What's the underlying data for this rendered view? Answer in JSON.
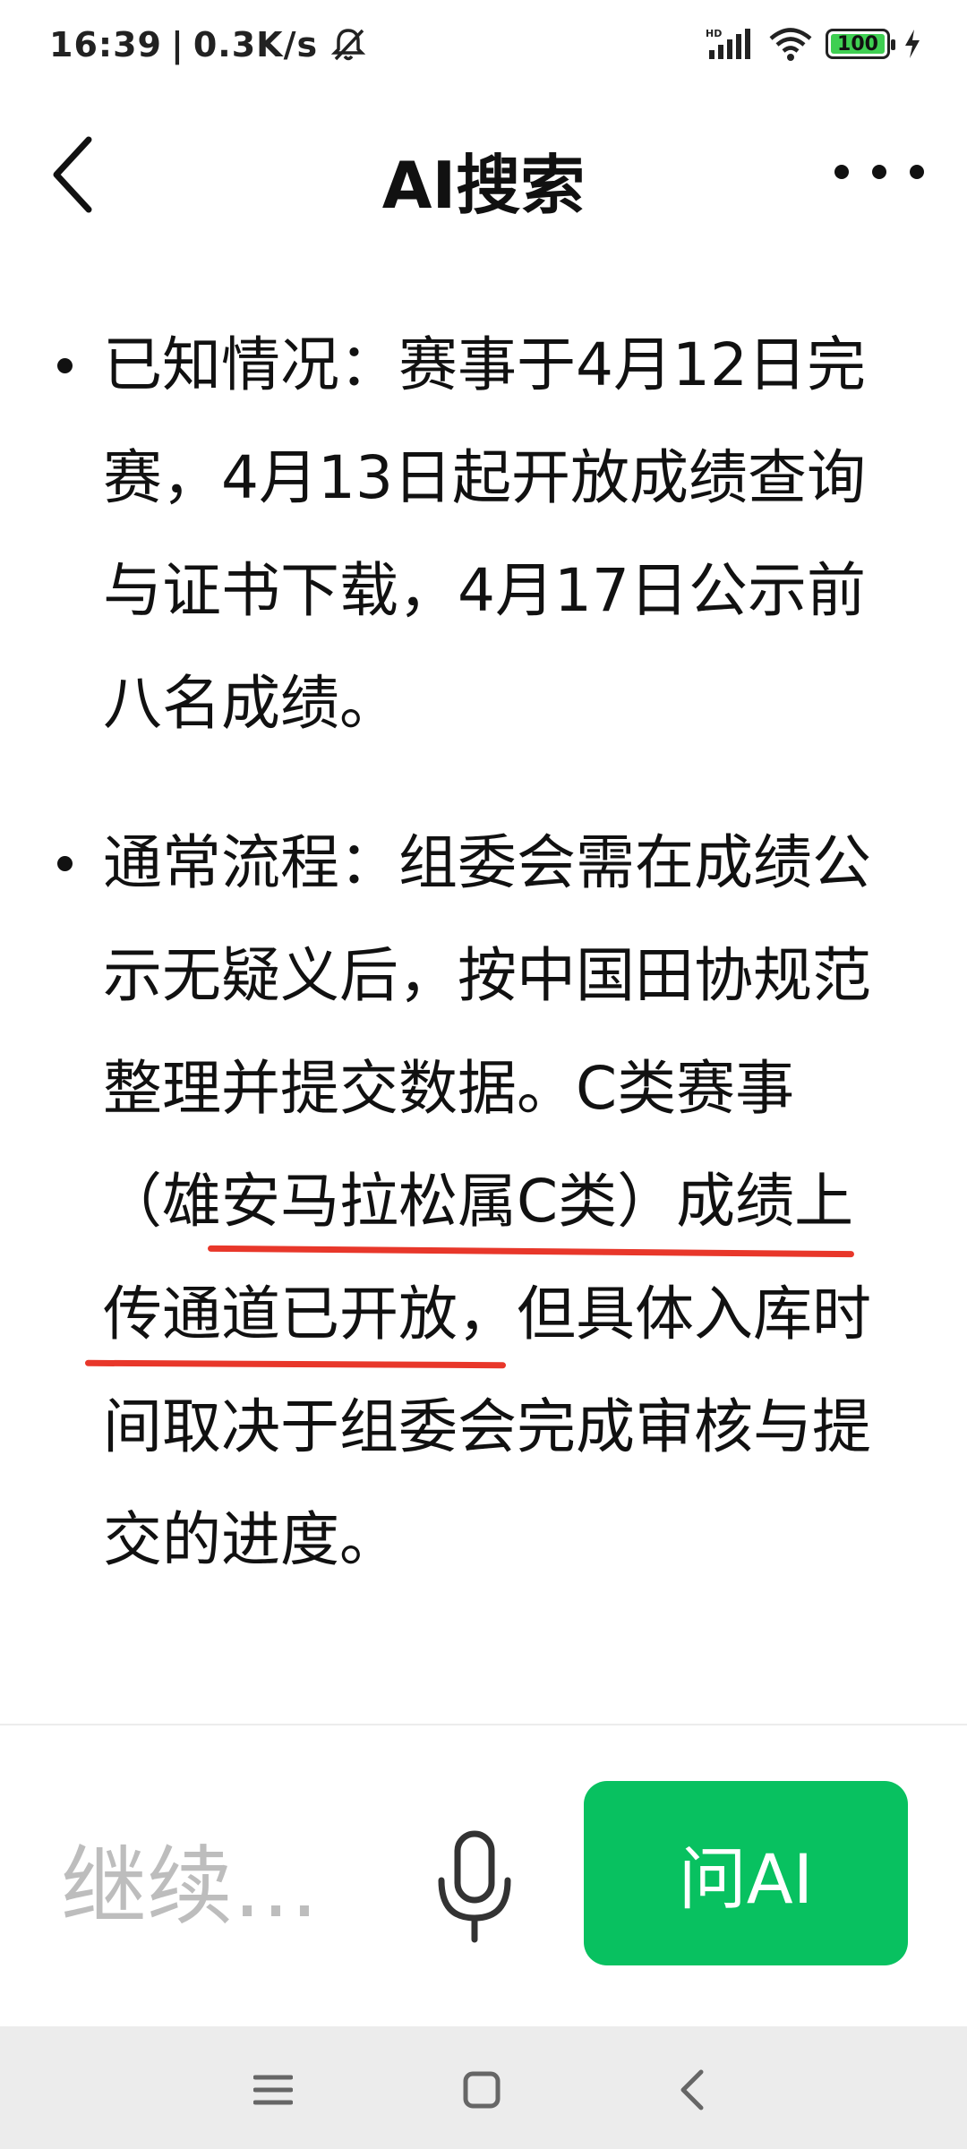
{
  "status_bar": {
    "time": "16:39",
    "separator": "|",
    "net_speed": "0.3K/s",
    "battery_level": "100",
    "icons": [
      "mute-icon",
      "hd-signal-icon",
      "wifi-icon",
      "battery-icon",
      "charging-icon"
    ]
  },
  "header": {
    "title": "AI搜索",
    "back_icon": "back-chevron-icon",
    "more_icon": "more-dots-icon"
  },
  "content": {
    "items": [
      {
        "text": "已知情况：赛事于4月12日完赛，4月13日起开放成绩查询与证书下载，4月17日公示前八名成绩。"
      },
      {
        "text": "通常流程：组委会需在成绩公示无疑义后，按中国田协规范整理并提交数据。C类赛事（雄安马拉松属C类）成绩上传通道已开放，但具体入库时间取决于组委会完成审核与提交的进度。"
      }
    ],
    "annotation_color": "#e8372a"
  },
  "input_bar": {
    "placeholder": "继续…",
    "ask_label": "问AI",
    "ask_color": "#08c160",
    "mic_icon": "microphone-icon"
  },
  "nav_bar": {
    "icons": [
      "menu-icon",
      "home-icon",
      "back-icon"
    ]
  }
}
